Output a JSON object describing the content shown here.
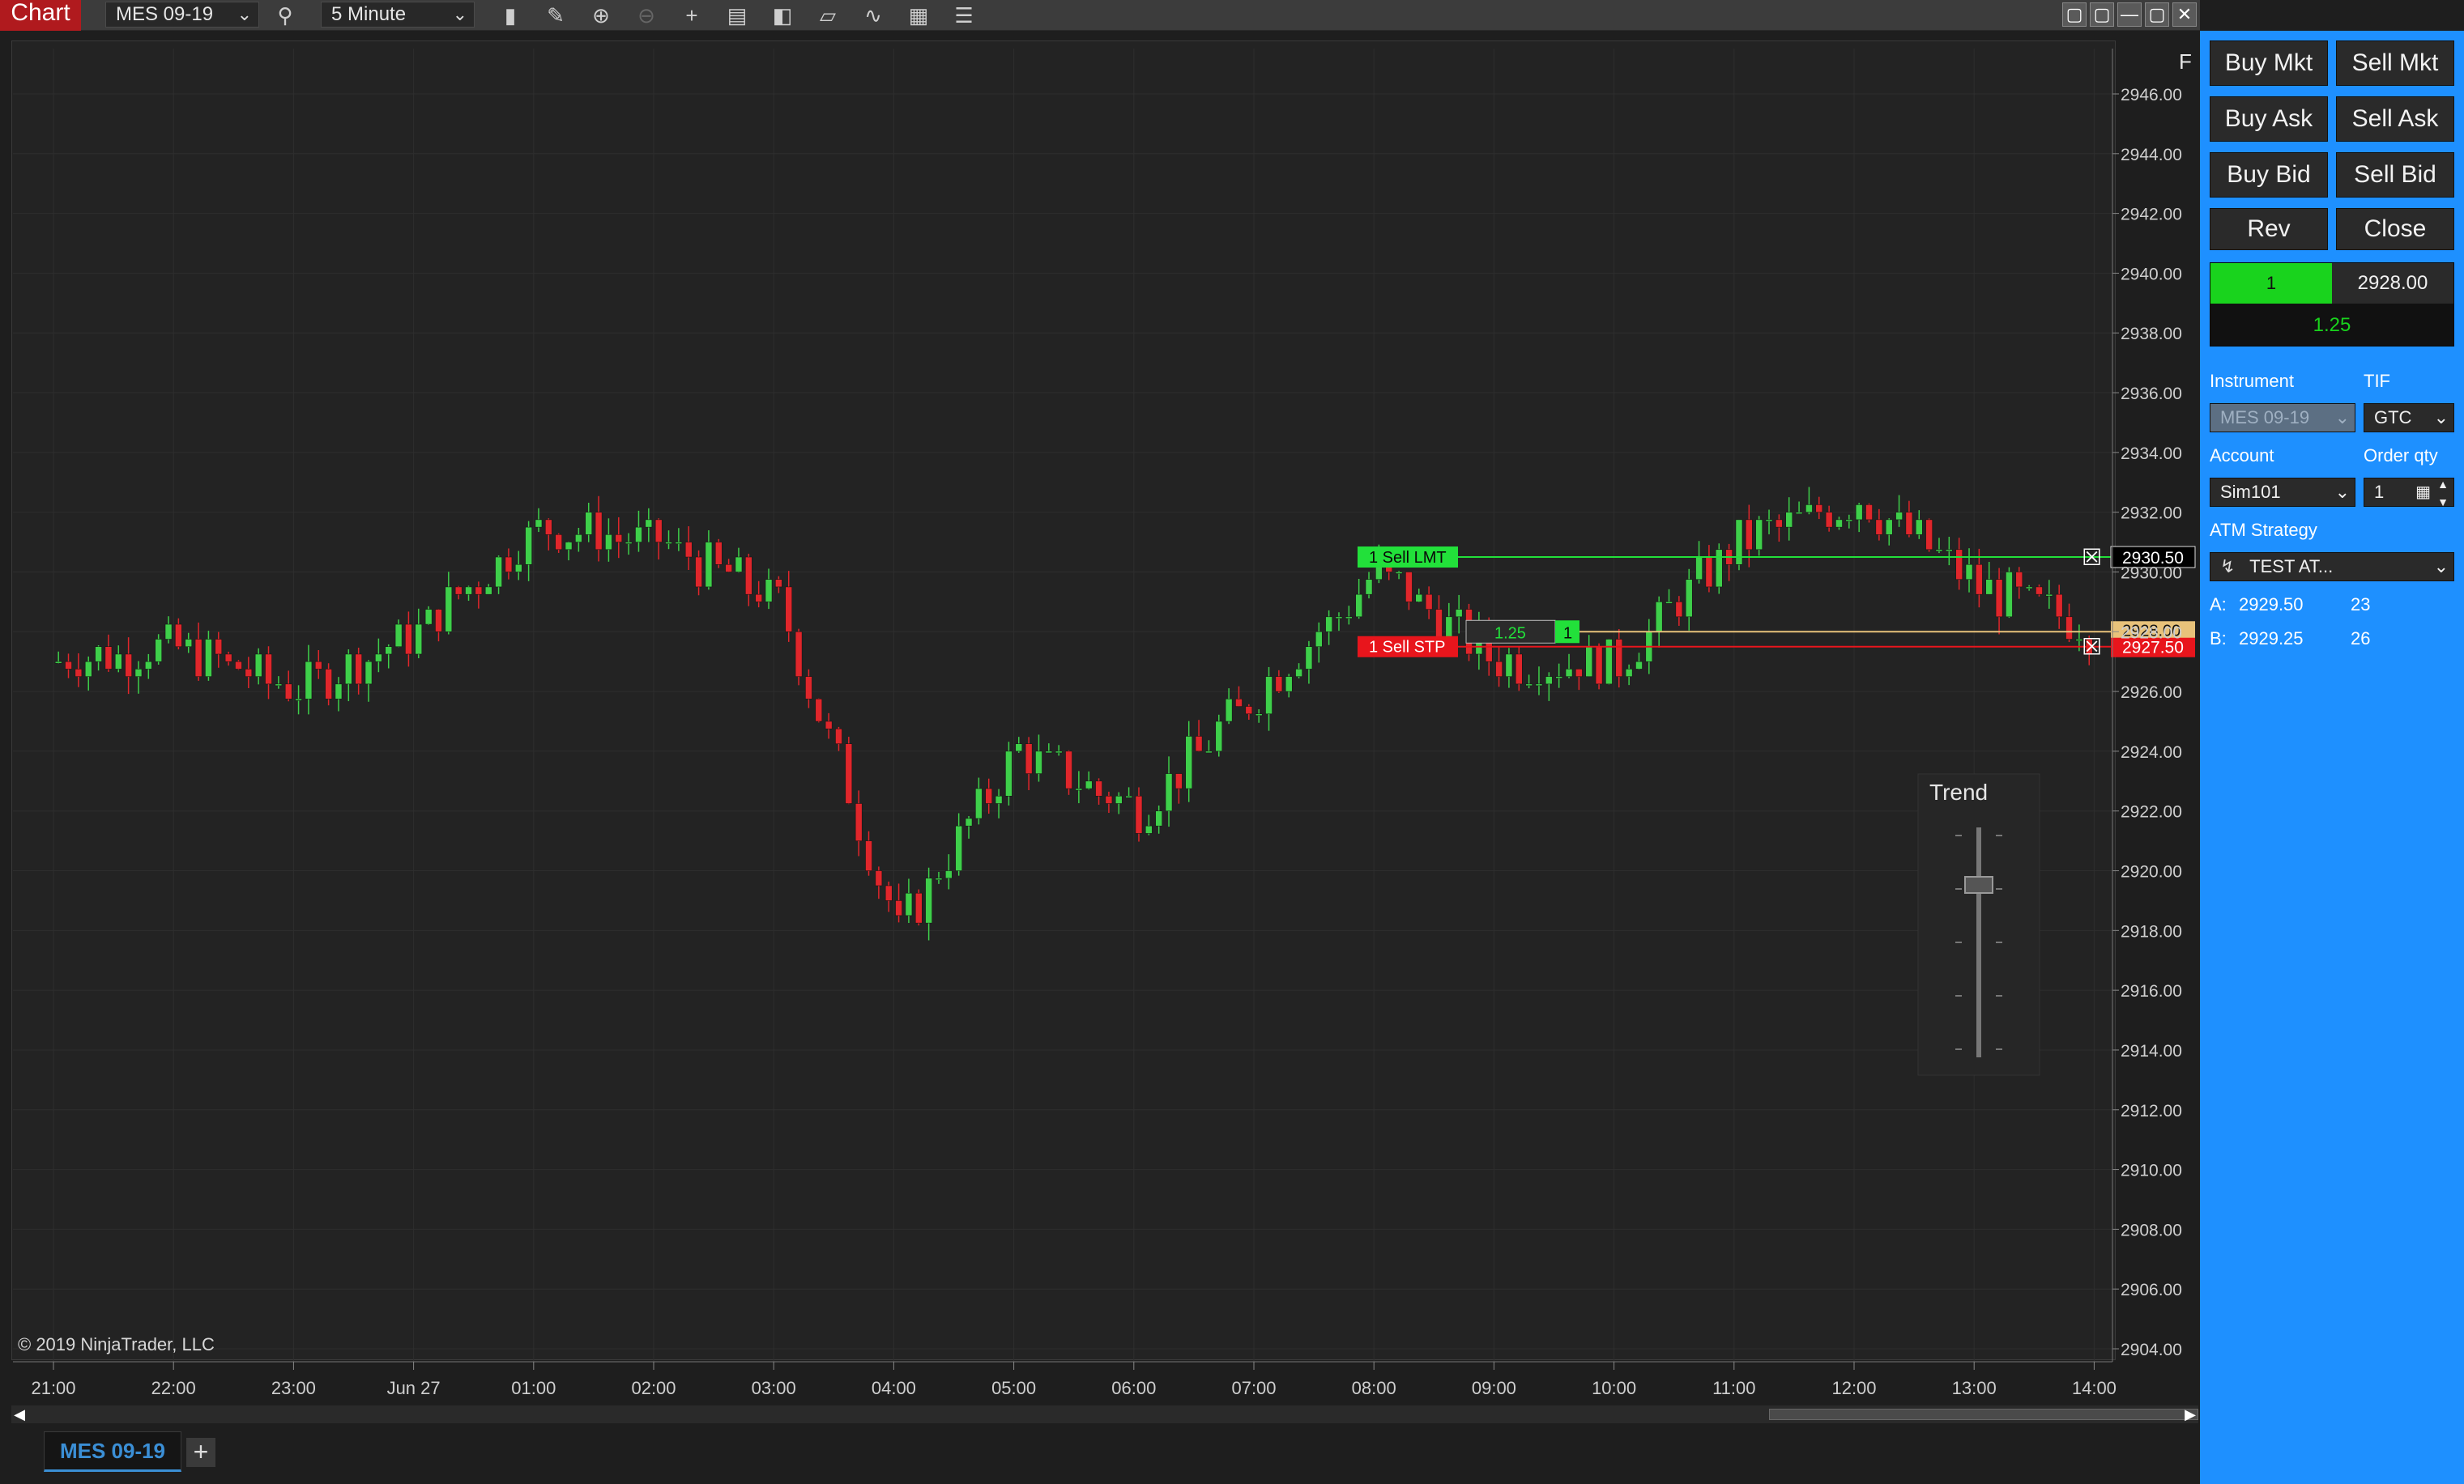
{
  "toolbar": {
    "title": "Chart",
    "instrument": "MES 09-19",
    "interval": "5 Minute",
    "icons": [
      "search-icon",
      "bar-style-icon",
      "drawing-tools-icon",
      "zoom-in-icon",
      "zoom-out-icon",
      "crosshair-icon",
      "data-box-icon",
      "indicators-icon",
      "strategies-icon",
      "chart-trader-icon",
      "properties-icon",
      "list-icon"
    ]
  },
  "window_controls": [
    "▢",
    "▢",
    "—",
    "▢",
    "✕"
  ],
  "chart": {
    "corner_label": "F",
    "copyright": "© 2019 NinjaTrader, LLC",
    "price_axis": [
      "2946.00",
      "2944.00",
      "2942.00",
      "2940.00",
      "2938.00",
      "2936.00",
      "2934.00",
      "2932.00",
      "2930.00",
      "2928.00",
      "2926.00",
      "2924.00",
      "2922.00",
      "2920.00",
      "2918.00",
      "2916.00",
      "2914.00",
      "2912.00",
      "2910.00",
      "2908.00",
      "2906.00",
      "2904.00"
    ],
    "time_axis": [
      "21:00",
      "22:00",
      "23:00",
      "Jun 27",
      "01:00",
      "02:00",
      "03:00",
      "04:00",
      "05:00",
      "06:00",
      "07:00",
      "08:00",
      "09:00",
      "10:00",
      "11:00",
      "12:00",
      "13:00",
      "14:00"
    ],
    "orders": {
      "sell_lmt": {
        "label": "1  Sell LMT",
        "price": "2930.50"
      },
      "sell_stp": {
        "label": "1  Sell STP",
        "price": "2927.50"
      },
      "position": {
        "pnl": "1.25",
        "qty": "1",
        "price": "2928.00"
      }
    },
    "trend_widget": {
      "title": "Trend",
      "level": 0.75
    },
    "colors": {
      "up": "#3ecf4a",
      "down": "#e0262b",
      "lmt": "#22e03a",
      "stp": "#e8151c",
      "position": "#e8c27a",
      "axis_text": "#cfcfcf"
    }
  },
  "chart_data": {
    "type": "candlestick",
    "ylim": [
      2904,
      2946
    ],
    "x": [
      "21:00",
      "22:00",
      "23:00",
      "Jun 27",
      "01:00",
      "02:00",
      "03:00",
      "04:00",
      "05:00",
      "06:00",
      "07:00",
      "08:00",
      "09:00",
      "10:00",
      "11:00",
      "12:00",
      "13:00",
      "14:00"
    ],
    "close": [
      2927.0,
      2927.5,
      2926.0,
      2928.0,
      2931.5,
      2931.0,
      2929.0,
      2918.0,
      2924.0,
      2922.0,
      2926.0,
      2930.0,
      2927.0,
      2927.0,
      2931.0,
      2932.5,
      2929.5,
      2928.0
    ]
  },
  "bottom_tab": {
    "label": "MES 09-19",
    "add": "+"
  },
  "chart_trader": {
    "buttons": [
      "Buy Mkt",
      "Sell Mkt",
      "Buy Ask",
      "Sell Ask",
      "Buy Bid",
      "Sell Bid",
      "Rev",
      "Close"
    ],
    "position_qty": "1",
    "position_price": "2928.00",
    "position_pnl": "1.25",
    "instrument_label": "Instrument",
    "instrument_value": "MES 09-19",
    "tif_label": "TIF",
    "tif_value": "GTC",
    "account_label": "Account",
    "account_value": "Sim101",
    "order_qty_label": "Order qty",
    "order_qty_value": "1",
    "atm_label": "ATM Strategy",
    "atm_value": "TEST AT...",
    "ask_label": "A:",
    "ask_price": "2929.50",
    "ask_size": "23",
    "bid_label": "B:",
    "bid_price": "2929.25",
    "bid_size": "26"
  }
}
